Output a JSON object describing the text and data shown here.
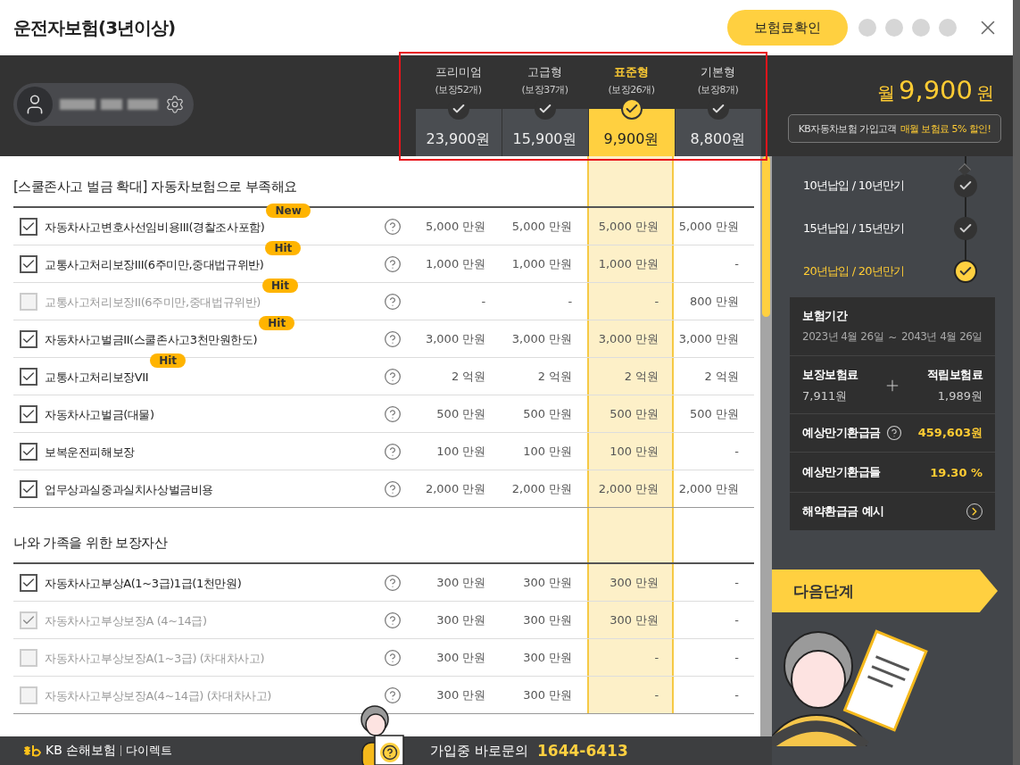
{
  "window": {
    "title": "운전자보험(3년이상)"
  },
  "header": {
    "confirm_button": "보험료확인",
    "steps": [
      {
        "selected": false
      },
      {
        "selected": false
      },
      {
        "selected": false
      },
      {
        "selected": false
      }
    ]
  },
  "plans": [
    {
      "name": "프리미엄",
      "coverage": "(보장52개)",
      "price": "23,900원",
      "selected": false
    },
    {
      "name": "고급형",
      "coverage": "(보장37개)",
      "price": "15,900원",
      "selected": false
    },
    {
      "name": "표준형",
      "coverage": "(보장26개)",
      "price": "9,900원",
      "selected": true
    },
    {
      "name": "기본형",
      "coverage": "(보장8개)",
      "price": "8,800원",
      "selected": false
    }
  ],
  "summary": {
    "prefix": "월",
    "amount": "9,900",
    "unit": "원",
    "notice_lead": "KB자동차보험 가입고객",
    "notice_highlight": "매월 보험료 5% 할인!"
  },
  "terms": [
    {
      "label": "10년납입 / 10년만기",
      "selected": false
    },
    {
      "label": "15년납입 / 15년만기",
      "selected": false
    },
    {
      "label": "20년납입 / 20년만기",
      "selected": true
    }
  ],
  "details": {
    "period_label": "보험기간",
    "start": "2023년 4월 26일",
    "separator": "~",
    "end": "2043년 4월 26일",
    "coverage_premium_label": "보장보험료",
    "coverage_premium": "7,911원",
    "savings_premium_label": "적립보험료",
    "savings_premium": "1,989원",
    "refund_label": "예상만기환급금",
    "refund": "459,603원",
    "rate_label": "예상만기환급들",
    "rate": "19.30 %",
    "surrender_link": "해약환급금 예시"
  },
  "next_button": "다음단계",
  "sections": [
    {
      "title": "[스쿨존사고 벌금 확대] 자동차보험으로 부족해요",
      "rows": [
        {
          "name": "자동차사고변호사선임비용III(경찰조사포함)",
          "checked": true,
          "disabled": false,
          "badge": "New",
          "values": [
            "5,000 만원",
            "5,000 만원",
            "5,000 만원",
            "5,000 만원"
          ]
        },
        {
          "name": "교통사고처리보장III(6주미만,중대법규위반)",
          "checked": true,
          "disabled": false,
          "badge": "Hit",
          "values": [
            "1,000 만원",
            "1,000 만원",
            "1,000 만원",
            "-"
          ]
        },
        {
          "name": "교통사고처리보장II(6주미만,중대법규위반)",
          "checked": false,
          "disabled": true,
          "badge": "Hit",
          "values": [
            "-",
            "-",
            "-",
            "800 만원"
          ]
        },
        {
          "name": "자동차사고벌금II(스쿨존사고3천만원한도)",
          "checked": true,
          "disabled": false,
          "badge": "Hit",
          "values": [
            "3,000 만원",
            "3,000 만원",
            "3,000 만원",
            "3,000 만원"
          ]
        },
        {
          "name": "교통사고처리보장VII",
          "checked": true,
          "disabled": false,
          "badge": "Hit",
          "values": [
            "2 억원",
            "2 억원",
            "2 억원",
            "2 억원"
          ]
        },
        {
          "name": "자동차사고벌금(대물)",
          "checked": true,
          "disabled": false,
          "values": [
            "500 만원",
            "500 만원",
            "500 만원",
            "500 만원"
          ]
        },
        {
          "name": "보복운전피해보장",
          "checked": true,
          "disabled": false,
          "values": [
            "100 만원",
            "100 만원",
            "100 만원",
            "-"
          ]
        },
        {
          "name": "업무상과실중과실치사상벌금비용",
          "checked": true,
          "disabled": false,
          "values": [
            "2,000 만원",
            "2,000 만원",
            "2,000 만원",
            "2,000 만원"
          ]
        }
      ]
    },
    {
      "title": "나와 가족을 위한 보장자산",
      "rows": [
        {
          "name": "자동차사고부상A(1~3급)1급(1천만원)",
          "checked": true,
          "disabled": false,
          "values": [
            "300 만원",
            "300 만원",
            "300 만원",
            "-"
          ]
        },
        {
          "name": "자동차사고부상보장A (4~14급)",
          "checked": true,
          "disabled": true,
          "values": [
            "300 만원",
            "300 만원",
            "300 만원",
            "-"
          ]
        },
        {
          "name": "자동차사고부상보장A(1~3급) (차대차사고)",
          "checked": false,
          "disabled": true,
          "values": [
            "300 만원",
            "300 만원",
            "-",
            "-"
          ]
        },
        {
          "name": "자동차사고부상보장A(4~14급) (차대차사고)",
          "checked": false,
          "disabled": true,
          "values": [
            "300 만원",
            "300 만원",
            "-",
            "-"
          ]
        }
      ]
    }
  ],
  "footer": {
    "brand": "KB 손해보험",
    "brand_sub": "다이렉트",
    "contact_label": "가입중 바로문의",
    "phone": "1644-6413"
  }
}
